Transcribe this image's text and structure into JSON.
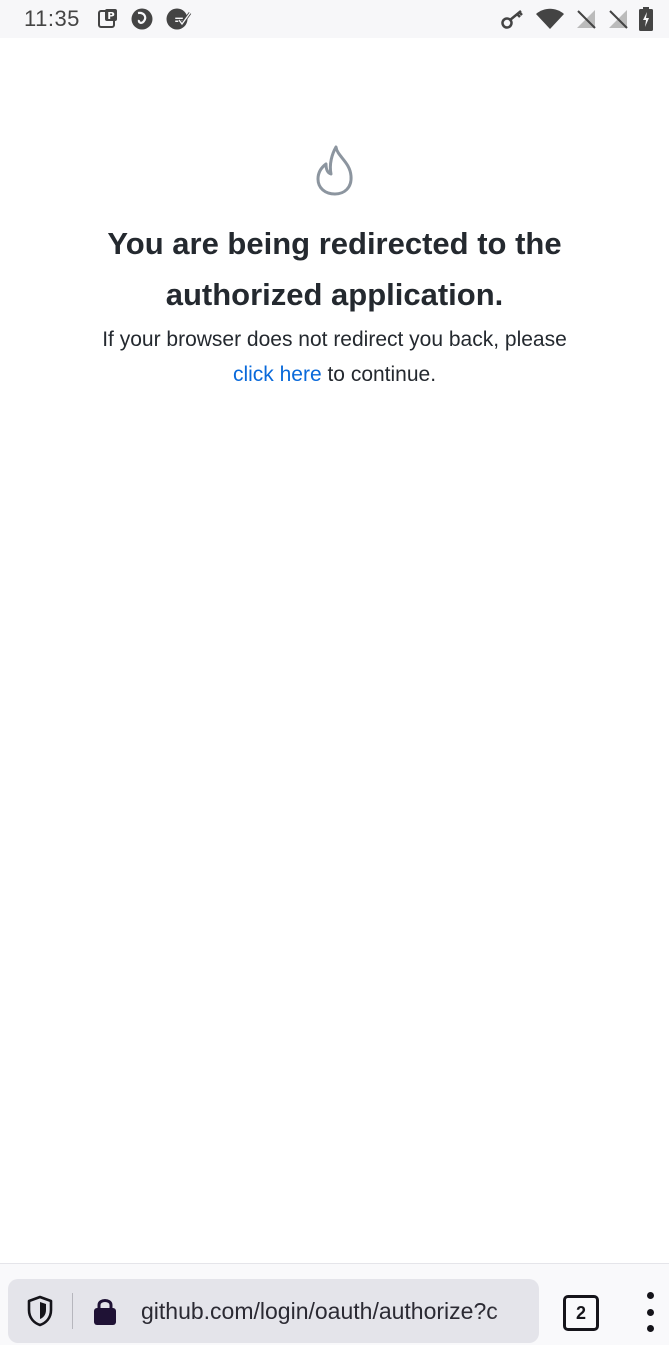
{
  "status_bar": {
    "time": "11:35",
    "left_icons": [
      "parking-notification-icon",
      "firefox-notification-icon",
      "sync-notification-icon"
    ],
    "right_icons": [
      "vpn-key-icon",
      "wifi-icon",
      "signal-off-icon",
      "signal-off-icon-2",
      "battery-charging-icon"
    ]
  },
  "page": {
    "icon": "flame-icon",
    "heading": "You are being redirected to the authorized application.",
    "subtext_before": "If your browser does not redirect you back, please",
    "link_text": "click here",
    "subtext_after": " to continue."
  },
  "browser_toolbar": {
    "url": "github.com/login/oauth/authorize?c",
    "tab_count": "2",
    "shield_icon": "tracking-protection-shield-icon",
    "lock_icon": "secure-lock-icon",
    "menu_icon": "overflow-menu-icon"
  },
  "colors": {
    "link": "#0969da",
    "text": "#24292f",
    "toolbar_bg": "#e4e4ea"
  }
}
